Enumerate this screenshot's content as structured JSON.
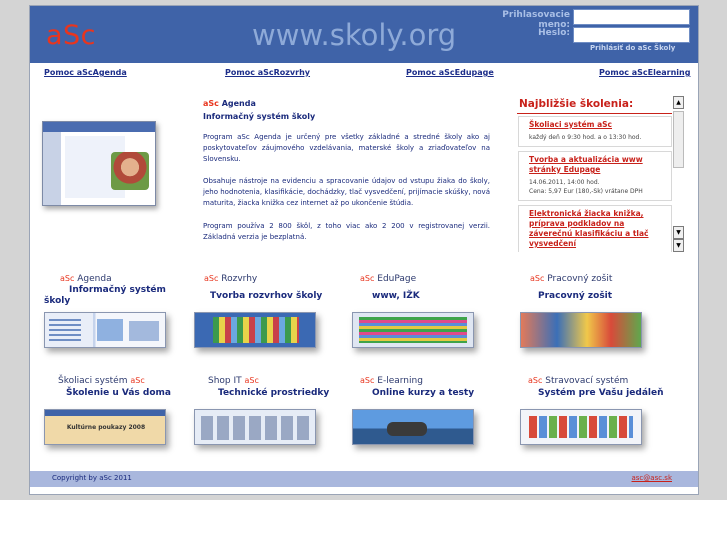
{
  "header": {
    "logo": "aSc",
    "site": "www.skoly.org",
    "login_name_label": "Prihlasovacie meno:",
    "password_label": "Heslo:",
    "login_name_value": "",
    "password_value": "",
    "login_link": "Prihlásiť do aSc Školy"
  },
  "help_nav": [
    "Pomoc aScAgenda",
    "Pomoc aScRozvrhy",
    "Pomoc aScEdupage",
    "Pomoc aScElearning"
  ],
  "intro": {
    "brand": "aSc",
    "product": "Agenda",
    "subtitle": "Informačný systém školy",
    "paragraphs": [
      "Program aSc Agenda je určený pre všetky základné a stredné školy ako aj poskytovateľov záujmového vzdelávania, materské školy a zriaďovateľov na Slovensku.",
      "Obsahuje nástroje na evidenciu a spracovanie údajov od vstupu žiaka do školy, jeho hodnotenia, klasifikácie, dochádzky, tlač vysvedčení, prijímacie skúšky, nová maturita, žiacka knižka cez internet až po ukončenie štúdia.",
      "Program používa 2 800 škôl, z toho viac ako 2 200 v registrovanej verzii. Základná verzia je bezplatná."
    ]
  },
  "trainings": {
    "title": "Najbližšie školenia:",
    "items": [
      {
        "title": "Školiaci systém aSc",
        "detail": "každý deň o 9:30 hod. a o 13:30 hod."
      },
      {
        "title": "Tvorba a aktualizácia www stránky Edupage",
        "detail": "14.06.2011, 14:00 hod.",
        "detail2": "Cena: 5,97 Eur (180,-Sk) vrátane DPH"
      },
      {
        "title": "Elektronická žiacka knižka, príprava podkladov na záverečnú klasifikáciu a tlač vysvedčení",
        "detail": ""
      }
    ],
    "scroll_up": "▲",
    "scroll_down": "▼"
  },
  "tiles": [
    {
      "brand": "aSc",
      "label": "Agenda",
      "subtitle": "Informačný systém",
      "subtitle2": "školy"
    },
    {
      "brand": "aSc",
      "label": "Rozvrhy",
      "subtitle": "Tvorba rozvrhov školy"
    },
    {
      "brand": "aSc",
      "label": "EduPage",
      "subtitle": "www, IŽK"
    },
    {
      "brand": "aSc",
      "label": "Pracovný zošit",
      "subtitle": "Pracovný zošit"
    },
    {
      "label": "Školiaci systém",
      "brand": "aSc",
      "subtitle": "Školenie u Vás doma",
      "shot_text": "Kultúrne poukazy 2008"
    },
    {
      "label": "Shop IT",
      "brand": "aSc",
      "subtitle": "Technické prostriedky"
    },
    {
      "brand": "aSc",
      "label": "E-learning",
      "subtitle": "Online kurzy a testy"
    },
    {
      "brand": "aSc",
      "label": "Stravovací systém",
      "subtitle": "Systém pre Vašu jedáleň"
    }
  ],
  "footer": {
    "copyright": "Copyright by aSc 2011",
    "email": "asc@asc.sk"
  },
  "colors": {
    "header_bg": "#3f63a8",
    "brand_red": "#e8351e",
    "link_blue": "#1d2e8a",
    "footer_bg": "#a9b7dd",
    "training_red": "#c8211a"
  }
}
